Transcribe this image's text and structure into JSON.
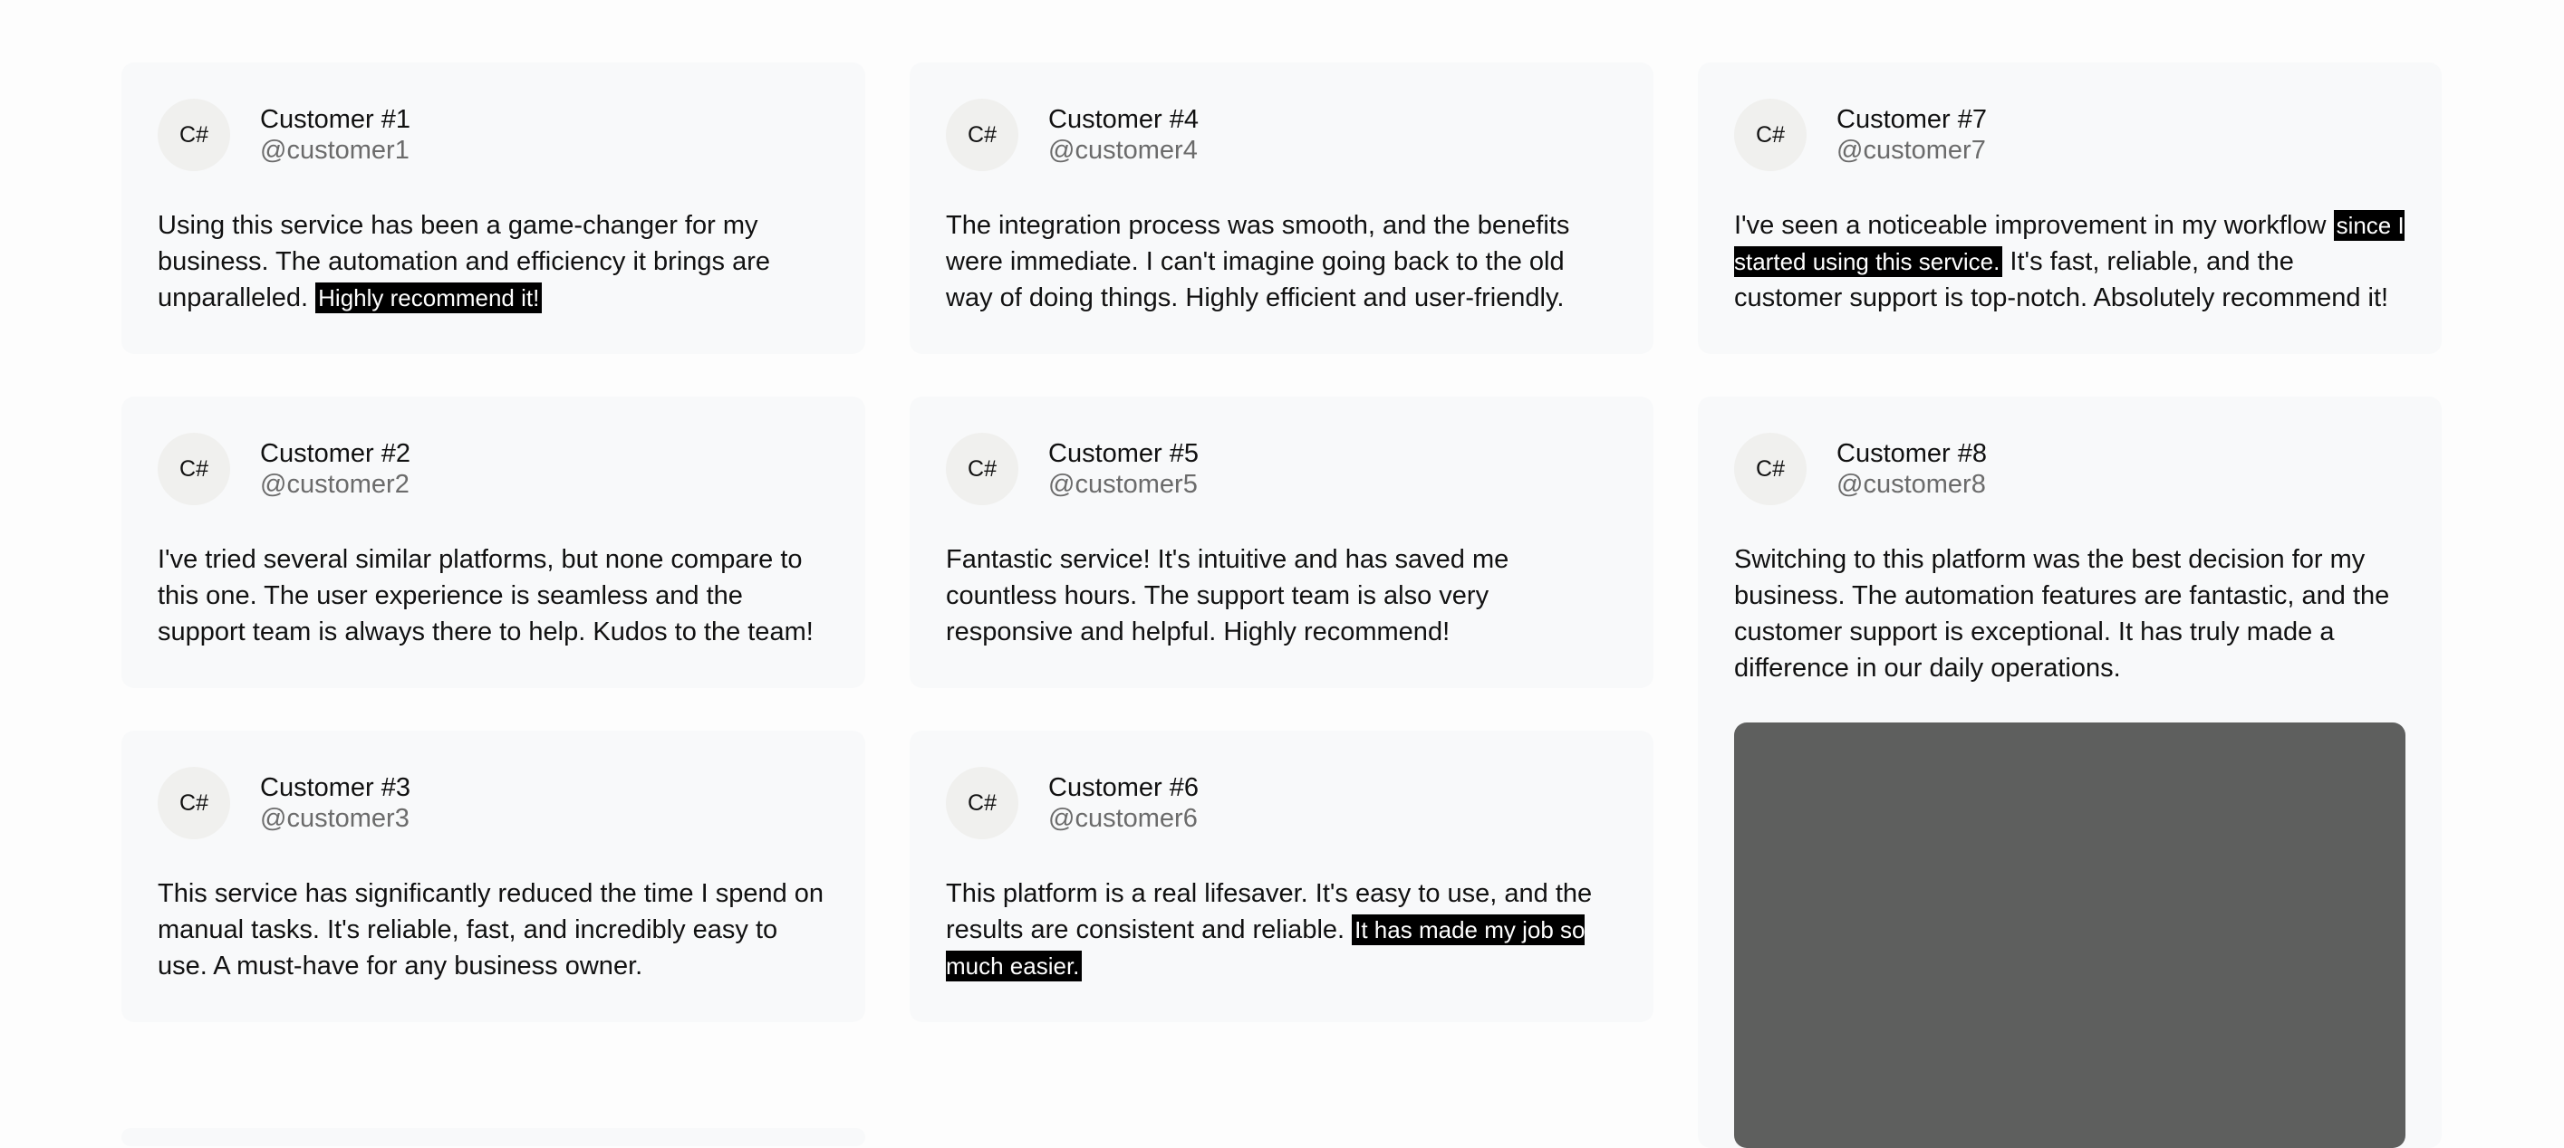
{
  "testimonials": [
    {
      "avatar": "C#",
      "name": "Customer #1",
      "handle": "@customer1",
      "text_before": "Using this service has been a game-changer for my business. The automation and efficiency it brings are unparalleled. ",
      "highlight": "Highly recommend it!",
      "text_after": ""
    },
    {
      "avatar": "C#",
      "name": "Customer #2",
      "handle": "@customer2",
      "text_before": "I've tried several similar platforms, but none compare to this one. The user experience is seamless and the support team is always there to help. Kudos to the team!",
      "highlight": "",
      "text_after": ""
    },
    {
      "avatar": "C#",
      "name": "Customer #3",
      "handle": "@customer3",
      "text_before": "This service has significantly reduced the time I spend on manual tasks. It's reliable, fast, and incredibly easy to use. A must-have for any business owner.",
      "highlight": "",
      "text_after": ""
    },
    {
      "avatar": "C#",
      "name": "Customer #4",
      "handle": "@customer4",
      "text_before": "The integration process was smooth, and the benefits were immediate. I can't imagine going back to the old way of doing things. Highly efficient and user-friendly.",
      "highlight": "",
      "text_after": ""
    },
    {
      "avatar": "C#",
      "name": "Customer #5",
      "handle": "@customer5",
      "text_before": "Fantastic service! It's intuitive and has saved me countless hours. The support team is also very responsive and helpful. Highly recommend!",
      "highlight": "",
      "text_after": ""
    },
    {
      "avatar": "C#",
      "name": "Customer #6",
      "handle": "@customer6",
      "text_before": "This platform is a real lifesaver. It's easy to use, and the results are consistent and reliable. ",
      "highlight": "It has made my job so much easier.",
      "text_after": ""
    },
    {
      "avatar": "C#",
      "name": "Customer #7",
      "handle": "@customer7",
      "text_before": "I've seen a noticeable improvement in my workflow ",
      "highlight": "since I started using this service.",
      "text_after": " It's fast, reliable, and the customer support is top-notch. Absolutely recommend it!"
    },
    {
      "avatar": "C#",
      "name": "Customer #8",
      "handle": "@customer8",
      "text_before": "Switching to this platform was the best decision for my business. The automation features are fantastic, and the customer support is exceptional. It has truly made a difference in our daily operations.",
      "highlight": "",
      "text_after": ""
    }
  ]
}
